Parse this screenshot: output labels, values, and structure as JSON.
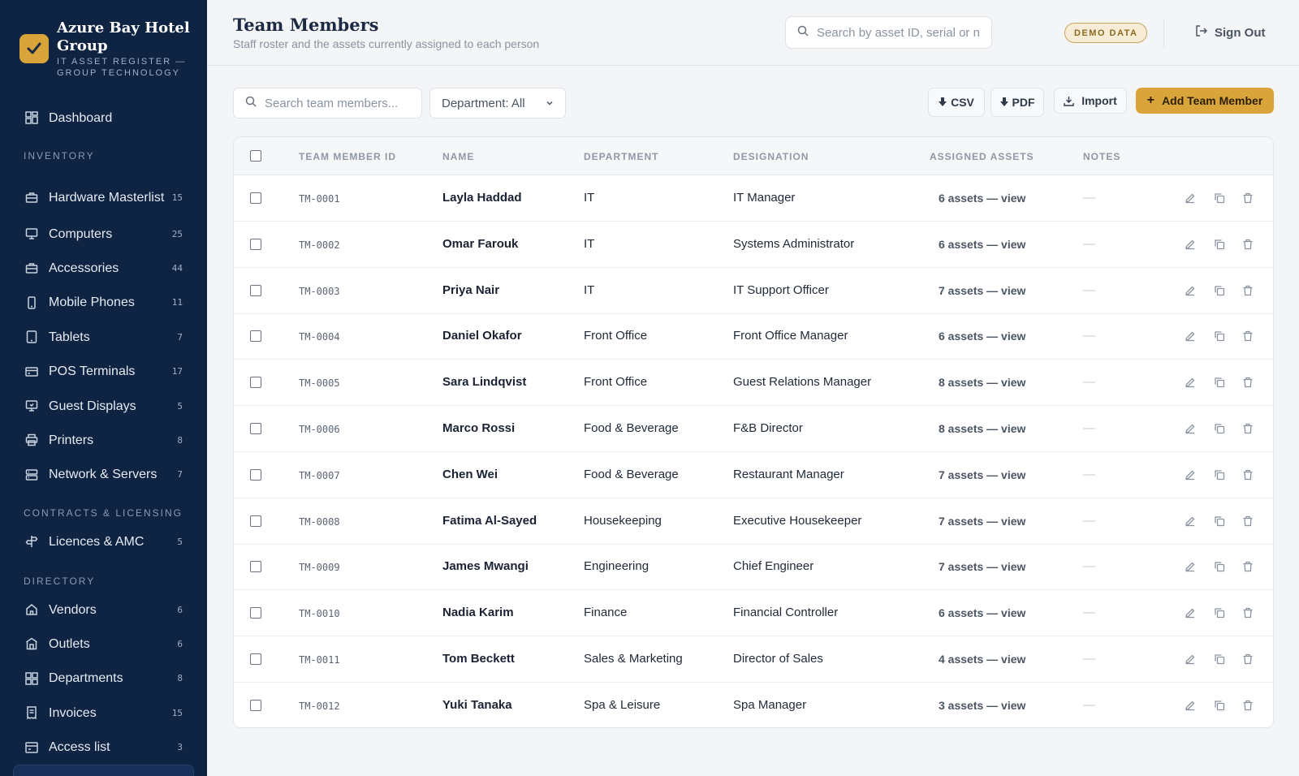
{
  "brand": {
    "title": "Azure Bay Hotel Group",
    "subtitle": "IT ASSET REGISTER — GROUP TECHNOLOGY"
  },
  "sidebar": {
    "dashboard": {
      "label": "Dashboard",
      "icon": "grid-icon"
    },
    "sections": {
      "inventory": "INVENTORY",
      "contracts": "CONTRACTS & LICENSING",
      "directory": "DIRECTORY"
    },
    "inventory_items": [
      {
        "label": "Hardware Masterlist",
        "count": "15",
        "icon": "briefcase-icon"
      },
      {
        "label": "Computers",
        "count": "25",
        "icon": "monitor-icon"
      },
      {
        "label": "Accessories",
        "count": "44",
        "icon": "briefcase-icon"
      },
      {
        "label": "Mobile Phones",
        "count": "11",
        "icon": "phone-icon"
      },
      {
        "label": "Tablets",
        "count": "7",
        "icon": "tablet-icon"
      },
      {
        "label": "POS Terminals",
        "count": "17",
        "icon": "card-icon"
      },
      {
        "label": "Guest Displays",
        "count": "5",
        "icon": "display-icon"
      },
      {
        "label": "Printers",
        "count": "8",
        "icon": "printer-icon"
      },
      {
        "label": "Network & Servers",
        "count": "7",
        "icon": "server-icon"
      }
    ],
    "contract_items": [
      {
        "label": "Licences & AMC",
        "count": "5",
        "icon": "signpost-icon"
      }
    ],
    "directory_items": [
      {
        "label": "Vendors",
        "count": "6",
        "icon": "home-icon"
      },
      {
        "label": "Outlets",
        "count": "6",
        "icon": "store-icon"
      },
      {
        "label": "Departments",
        "count": "8",
        "icon": "grid-icon"
      },
      {
        "label": "Invoices",
        "count": "15",
        "icon": "receipt-icon"
      },
      {
        "label": "Access list",
        "count": "3",
        "icon": "list-icon"
      }
    ]
  },
  "header": {
    "title": "Team Members",
    "subtitle": "Staff roster and the assets currently assigned to each person",
    "search_placeholder": "Search by asset ID, serial or name...",
    "badge": "DEMO DATA",
    "sign_out": "Sign Out"
  },
  "toolbar": {
    "search_placeholder": "Search team members...",
    "department_filter": "Department: All",
    "csv": "CSV",
    "pdf": "PDF",
    "import": "Import",
    "add": "Add Team Member"
  },
  "table": {
    "columns": [
      "TEAM MEMBER ID",
      "NAME",
      "DEPARTMENT",
      "DESIGNATION",
      "ASSIGNED ASSETS",
      "NOTES"
    ],
    "rows": [
      {
        "id": "TM-0001",
        "name": "Layla Haddad",
        "department": "IT",
        "designation": "IT Manager",
        "assets": "6 assets — view",
        "notes": "—"
      },
      {
        "id": "TM-0002",
        "name": "Omar Farouk",
        "department": "IT",
        "designation": "Systems Administrator",
        "assets": "6 assets — view",
        "notes": "—"
      },
      {
        "id": "TM-0003",
        "name": "Priya Nair",
        "department": "IT",
        "designation": "IT Support Officer",
        "assets": "7 assets — view",
        "notes": "—"
      },
      {
        "id": "TM-0004",
        "name": "Daniel Okafor",
        "department": "Front Office",
        "designation": "Front Office Manager",
        "assets": "6 assets — view",
        "notes": "—"
      },
      {
        "id": "TM-0005",
        "name": "Sara Lindqvist",
        "department": "Front Office",
        "designation": "Guest Relations Manager",
        "assets": "8 assets — view",
        "notes": "—"
      },
      {
        "id": "TM-0006",
        "name": "Marco Rossi",
        "department": "Food & Beverage",
        "designation": "F&B Director",
        "assets": "8 assets — view",
        "notes": "—"
      },
      {
        "id": "TM-0007",
        "name": "Chen Wei",
        "department": "Food & Beverage",
        "designation": "Restaurant Manager",
        "assets": "7 assets — view",
        "notes": "—"
      },
      {
        "id": "TM-0008",
        "name": "Fatima Al-Sayed",
        "department": "Housekeeping",
        "designation": "Executive Housekeeper",
        "assets": "7 assets — view",
        "notes": "—"
      },
      {
        "id": "TM-0009",
        "name": "James Mwangi",
        "department": "Engineering",
        "designation": "Chief Engineer",
        "assets": "7 assets — view",
        "notes": "—"
      },
      {
        "id": "TM-0010",
        "name": "Nadia Karim",
        "department": "Finance",
        "designation": "Financial Controller",
        "assets": "6 assets — view",
        "notes": "—"
      },
      {
        "id": "TM-0011",
        "name": "Tom Beckett",
        "department": "Sales & Marketing",
        "designation": "Director of Sales",
        "assets": "4 assets — view",
        "notes": "—"
      },
      {
        "id": "TM-0012",
        "name": "Yuki Tanaka",
        "department": "Spa & Leisure",
        "designation": "Spa Manager",
        "assets": "3 assets — view",
        "notes": "—"
      }
    ]
  },
  "colors": {
    "sidebar_bg": "#0f2342",
    "accent": "#d9a53a",
    "page_bg": "#f4f5f7"
  }
}
